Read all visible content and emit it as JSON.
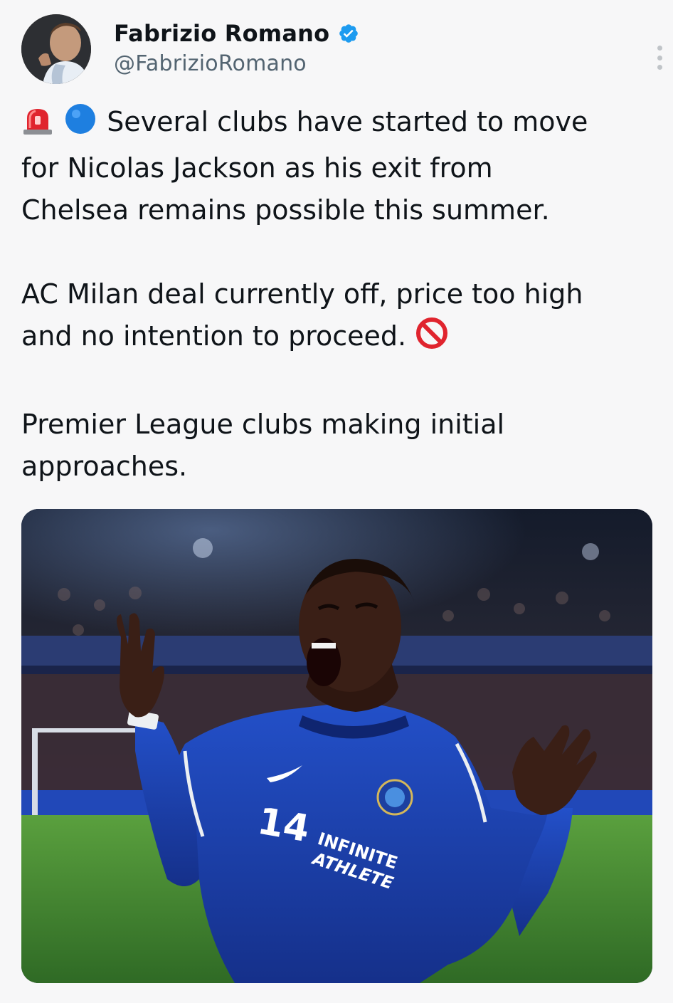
{
  "author": {
    "display_name": "Fabrizio Romano",
    "handle": "@FabrizioRomano",
    "verified": true,
    "avatar_icon": "profile-photo"
  },
  "tweet": {
    "line1": "Several clubs have started to move",
    "line2": "for Nicolas Jackson as his exit from",
    "line3": "Chelsea remains possible this summer.",
    "para2_line1": "AC Milan deal currently off, price too high",
    "para2_line2": "and no intention to proceed.",
    "para3_line1": "Premier League clubs making initial",
    "para3_line2": "approaches.",
    "emojis": [
      "siren-emoji",
      "blue-circle-emoji",
      "prohibited-emoji"
    ]
  },
  "media": {
    "shirt_number": "14",
    "sponsor_line1": "INFINITE",
    "sponsor_line2": "ATHLETE"
  },
  "colors": {
    "accent": "#1d9bf0",
    "jersey": "#1a3fa8",
    "pitch": "#3b7d2f",
    "background": "#f7f7f8"
  }
}
